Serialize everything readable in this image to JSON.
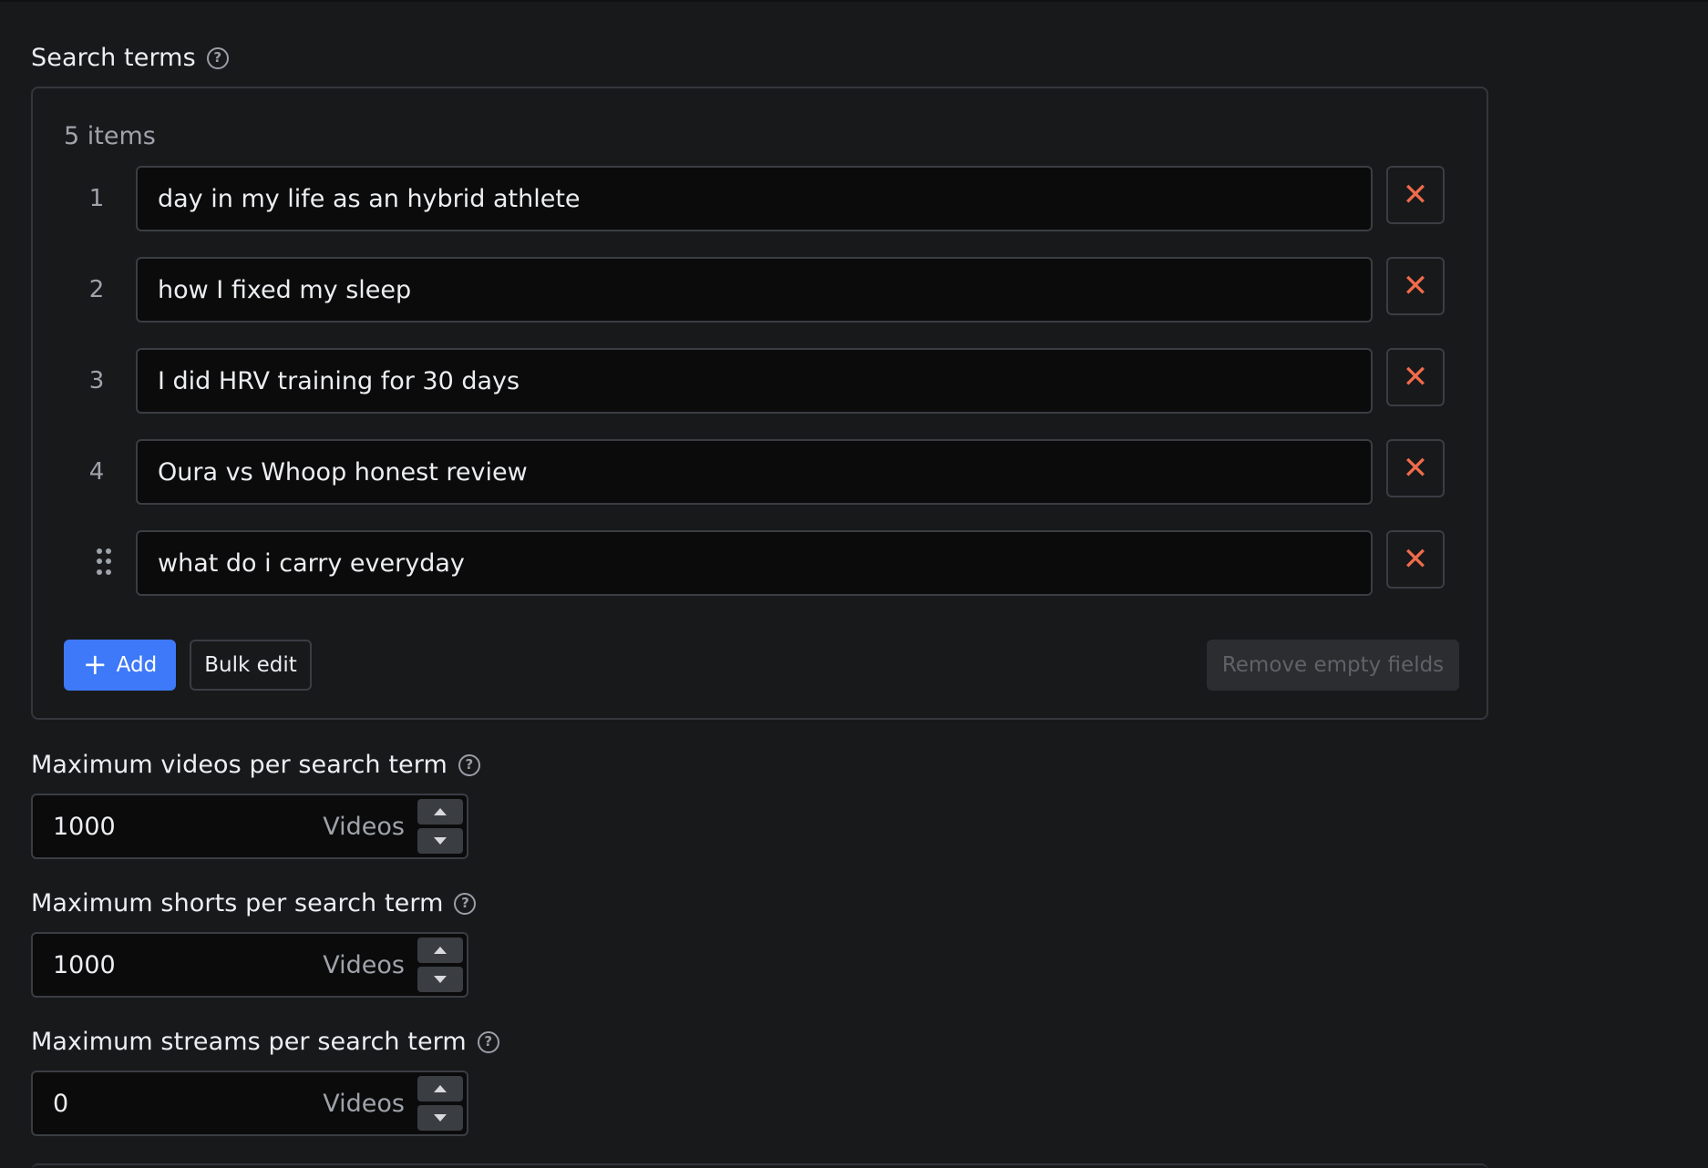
{
  "search_terms": {
    "label": "Search terms",
    "count_label": "5 items",
    "items": [
      {
        "index": "1",
        "value": "day in my life as an hybrid athlete"
      },
      {
        "index": "2",
        "value": "how I fixed my sleep"
      },
      {
        "index": "3",
        "value": "I did HRV training for 30 days"
      },
      {
        "index": "4",
        "value": "Oura vs Whoop honest review"
      },
      {
        "index": "",
        "value": "what do i carry everyday"
      }
    ],
    "remove_icon": "close-icon",
    "add_label": "Add",
    "bulk_edit_label": "Bulk edit",
    "remove_empty_label": "Remove empty fields"
  },
  "max_videos": {
    "label": "Maximum videos per search term",
    "value": "1000",
    "unit": "Videos"
  },
  "max_shorts": {
    "label": "Maximum shorts per search term",
    "value": "1000",
    "unit": "Videos"
  },
  "max_streams": {
    "label": "Maximum streams per search term",
    "value": "0",
    "unit": "Videos"
  },
  "colors": {
    "background": "#18191b",
    "accent": "#3d79f8",
    "danger": "#ef6b4a",
    "border": "#3a3d42",
    "input_bg": "#0b0b0c"
  }
}
